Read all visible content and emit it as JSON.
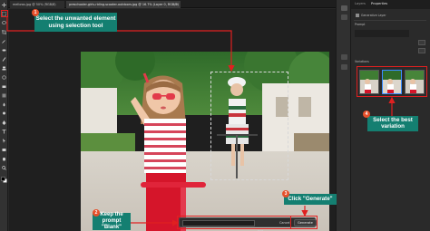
{
  "window": {
    "tab_1": "mellows.jpg @ 50% (RGB/8)",
    "tab_2": "preschooler-girls-riding-scooter-outdoors.jpg @ 16.7% (Layer 0, RGB/8)",
    "tab_close": "×"
  },
  "panel": {
    "tab_layers": "Layers",
    "tab_properties": "Properties",
    "section_title": "Generative Layer",
    "prompt_label": "Prompt",
    "variations_label": "Variations",
    "variation_count": 3,
    "selected_variation": 2
  },
  "taskbar": {
    "prompt_placeholder": "",
    "cancel_label": "Cancel",
    "generate_label": "Generate"
  },
  "annotations": {
    "step1_text": "Select the unwanted element using selection tool",
    "step2_text": "Keep the prompt \"Blank\"",
    "step3_text": "Click \"Generate\"",
    "step4_text": "Select the best variation",
    "badge_1": "1",
    "badge_2": "2",
    "badge_3": "3",
    "badge_4": "4"
  },
  "colors": {
    "callout_bg": "#147f71",
    "highlight_red": "#e02020",
    "badge_orange": "#e6502b",
    "selected_blue": "#3b8cff"
  },
  "icons": {
    "move_tool": "move-icon",
    "marquee_tool": "rectangular-marquee-icon",
    "lasso_tool": "lasso-icon",
    "crop_tool": "crop-icon",
    "brush_tool": "brush-icon",
    "type_tool": "type-icon",
    "hand_tool": "hand-icon",
    "zoom_tool": "zoom-icon"
  }
}
